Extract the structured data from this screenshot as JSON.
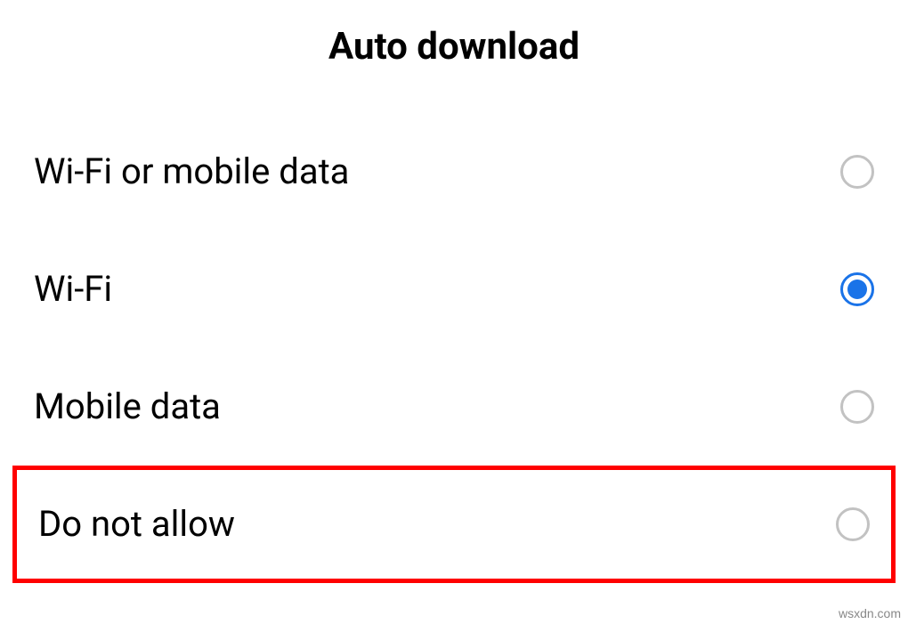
{
  "title": "Auto download",
  "options": [
    {
      "label": "Wi-Fi or mobile data",
      "selected": false,
      "highlighted": false
    },
    {
      "label": "Wi-Fi",
      "selected": true,
      "highlighted": false
    },
    {
      "label": "Mobile data",
      "selected": false,
      "highlighted": false
    },
    {
      "label": "Do not allow",
      "selected": false,
      "highlighted": true
    }
  ],
  "watermark": "wsxdn.com"
}
